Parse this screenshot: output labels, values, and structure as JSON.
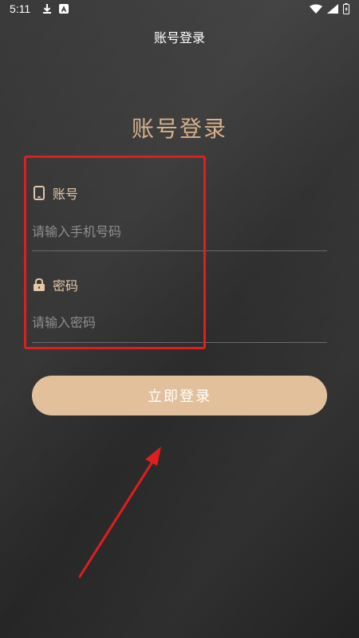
{
  "status_bar": {
    "time": "5:11",
    "left_icons": [
      "download-icon",
      "a-badge-icon"
    ],
    "right_icons": [
      "wifi-icon",
      "signal-icon",
      "battery-icon"
    ]
  },
  "appbar": {
    "title": "账号登录"
  },
  "login": {
    "title": "账号登录",
    "account_label": "账号",
    "account_placeholder": "请输入手机号码",
    "password_label": "密码",
    "password_placeholder": "请输入密码",
    "submit_label": "立即登录"
  },
  "colors": {
    "accent": "#e2c09b",
    "label": "#e3c7a8",
    "title": "#d8b089",
    "annotation": "#e11d1d"
  }
}
